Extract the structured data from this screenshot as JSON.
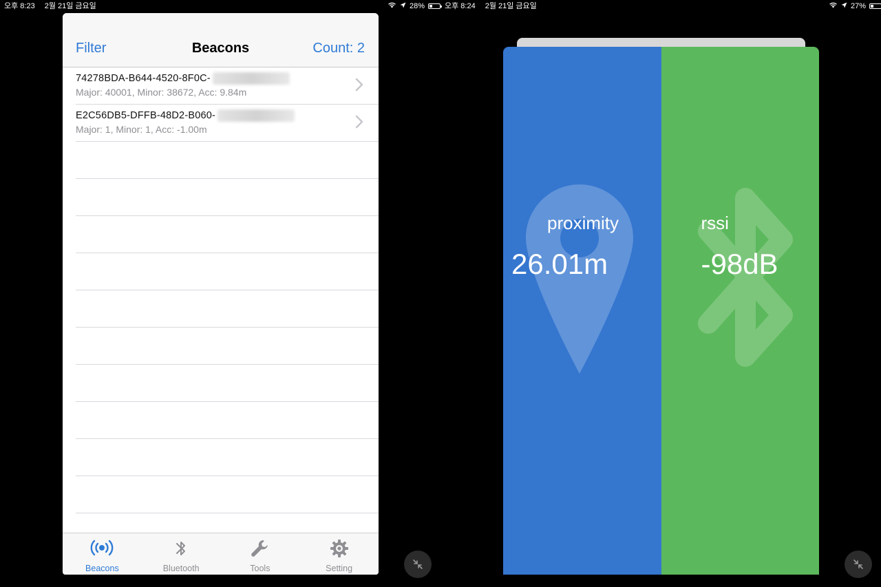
{
  "status_left": {
    "time": "오후 8:23",
    "date": "2월 21일 금요일",
    "battery": "28%"
  },
  "status_right": {
    "time": "오후 8:24",
    "date": "2월 21일 금요일",
    "battery": "27%"
  },
  "navbar": {
    "filter_label": "Filter",
    "title": "Beacons",
    "count_label": "Count: 2"
  },
  "beacons": [
    {
      "uuid": "74278BDA-B644-4520-8F0C-",
      "detail": "Major: 40001, Minor: 38672, Acc: 9.84m"
    },
    {
      "uuid": "E2C56DB5-DFFB-48D2-B060-",
      "detail": "Major: 1, Minor: 1, Acc: -1.00m"
    }
  ],
  "tabs": [
    {
      "label": "Beacons",
      "icon": "beacon-icon",
      "active": true
    },
    {
      "label": "Bluetooth",
      "icon": "bluetooth-icon",
      "active": false
    },
    {
      "label": "Tools",
      "icon": "wrench-icon",
      "active": false
    },
    {
      "label": "Setting",
      "icon": "gear-icon",
      "active": false
    }
  ],
  "proximity": {
    "label": "proximity",
    "value": "26.01m"
  },
  "rssi": {
    "label": "rssi",
    "value": "-98dB"
  },
  "colors": {
    "accent": "#2f7bd6",
    "proximity_bg": "#3576cf",
    "rssi_bg": "#5cb85c"
  }
}
